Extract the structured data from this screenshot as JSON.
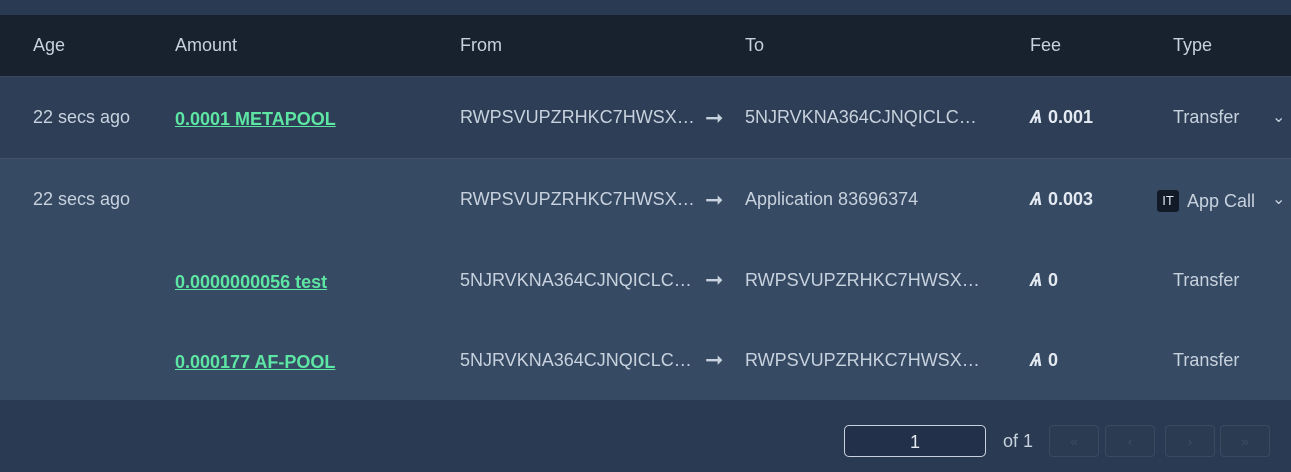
{
  "headers": {
    "age": "Age",
    "amount": "Amount",
    "from": "From",
    "to": "To",
    "fee": "Fee",
    "type": "Type"
  },
  "rows": [
    {
      "age": "22 secs ago",
      "amount": "0.0001 METAPOOL",
      "from": "RWPSVUPZRHKC7HWSX…",
      "to": "5NJRVKNA364CJNQICLC…",
      "fee": "0.001",
      "type": "Transfer"
    }
  ],
  "group": {
    "main": {
      "age": "22 secs ago",
      "from": "RWPSVUPZRHKC7HWSX…",
      "to": "Application 83696374",
      "fee": "0.003",
      "type_icon": "IT",
      "type": "App Call"
    },
    "inner": [
      {
        "amount": "0.0000000056 test",
        "from": "5NJRVKNA364CJNQICLC…",
        "to": "RWPSVUPZRHKC7HWSX…",
        "fee": "0",
        "type": "Transfer"
      },
      {
        "amount": "0.000177 AF-POOL",
        "from": "5NJRVKNA364CJNQICLC…",
        "to": "RWPSVUPZRHKC7HWSX…",
        "fee": "0",
        "type": "Transfer"
      }
    ]
  },
  "icons": {
    "arrow": "arrow-right-icon",
    "algo": "algo-icon",
    "chevron": "chevron-down-icon"
  },
  "pagination": {
    "current_page": "1",
    "of_label": "of 1",
    "first": "«",
    "prev": "‹",
    "next": "›",
    "last": "»"
  },
  "colors": {
    "link": "#5de6a3",
    "header_bg": "#18222f",
    "row_bg": "#2e3e56",
    "group_bg": "#364a63"
  }
}
